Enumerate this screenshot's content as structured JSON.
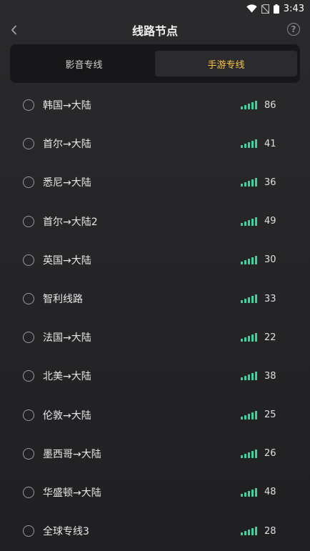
{
  "status": {
    "time": "3:43"
  },
  "header": {
    "title": "线路节点"
  },
  "tabs": [
    {
      "label": "影音专线",
      "active": false
    },
    {
      "label": "手游专线",
      "active": true
    }
  ],
  "routes": [
    {
      "name": "韩国→大陆",
      "ping": "86"
    },
    {
      "name": "首尔→大陆",
      "ping": "41"
    },
    {
      "name": "悉尼→大陆",
      "ping": "36"
    },
    {
      "name": "首尔→大陆2",
      "ping": "49"
    },
    {
      "name": "英国→大陆",
      "ping": "30"
    },
    {
      "name": "智利线路",
      "ping": "33"
    },
    {
      "name": "法国→大陆",
      "ping": "22"
    },
    {
      "name": "北美→大陆",
      "ping": "38"
    },
    {
      "name": "伦敦→大陆",
      "ping": "25"
    },
    {
      "name": "墨西哥→大陆",
      "ping": "26"
    },
    {
      "name": "华盛顿→大陆",
      "ping": "48"
    },
    {
      "name": "全球专线3",
      "ping": "28"
    }
  ],
  "colors": {
    "accent": "#f5c542",
    "signal": "#3fd29c"
  }
}
